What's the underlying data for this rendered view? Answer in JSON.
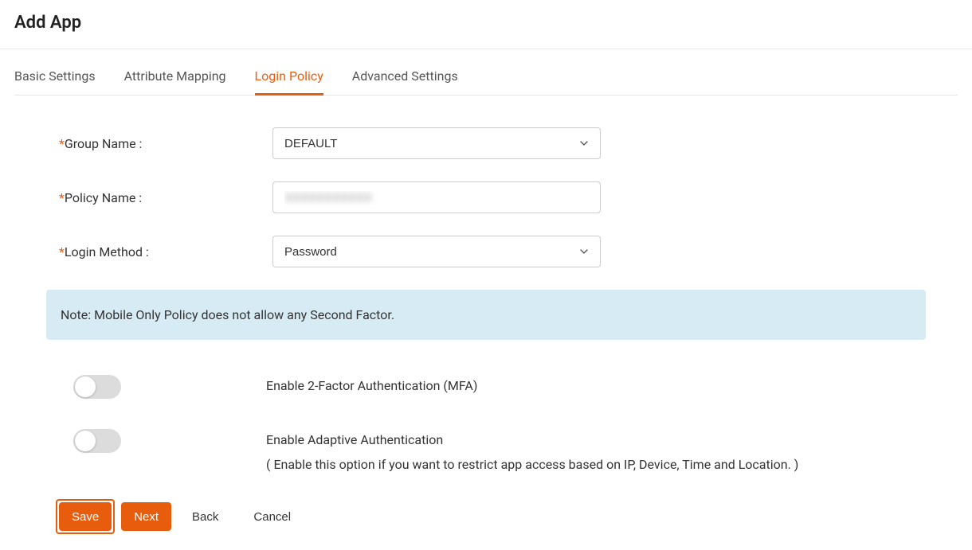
{
  "header": {
    "title": "Add App"
  },
  "tabs": [
    {
      "label": "Basic Settings",
      "active": false
    },
    {
      "label": "Attribute Mapping",
      "active": false
    },
    {
      "label": "Login Policy",
      "active": true
    },
    {
      "label": "Advanced Settings",
      "active": false
    }
  ],
  "form": {
    "groupName": {
      "label": "Group Name :",
      "value": "DEFAULT"
    },
    "policyName": {
      "label": "Policy Name :",
      "value": "XXXXXXXXXXX"
    },
    "loginMethod": {
      "label": "Login Method :",
      "value": "Password"
    }
  },
  "note": "Note: Mobile Only Policy does not allow any Second Factor.",
  "toggles": {
    "mfa": {
      "enabled": false,
      "label": "Enable 2-Factor Authentication (MFA)"
    },
    "adaptive": {
      "enabled": false,
      "label": "Enable Adaptive Authentication",
      "sublabel": "( Enable this option if you want to restrict app access based on IP, Device, Time and Location. )"
    }
  },
  "buttons": {
    "save": "Save",
    "next": "Next",
    "back": "Back",
    "cancel": "Cancel"
  }
}
